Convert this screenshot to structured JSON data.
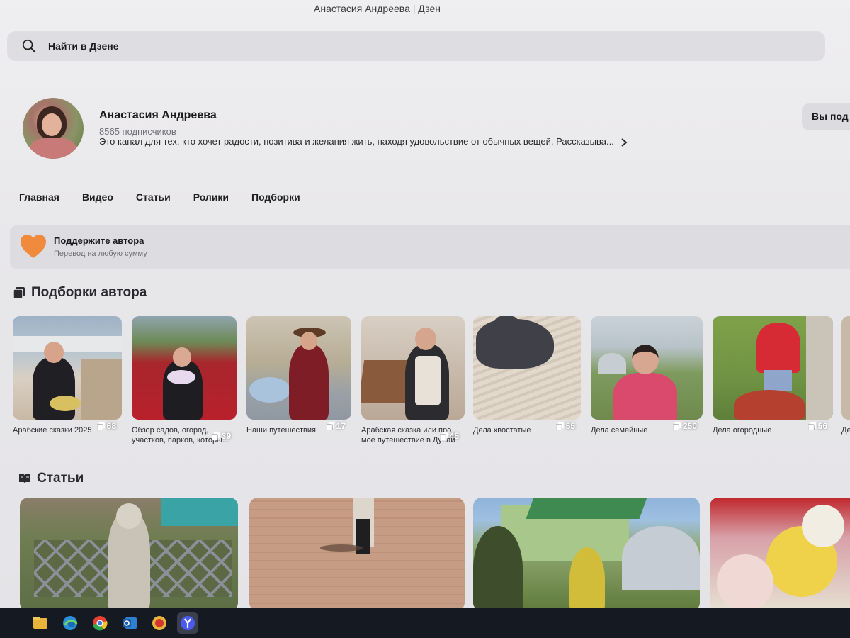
{
  "window": {
    "title": "Анастасия Андреева | Дзен"
  },
  "search": {
    "placeholder": "Найти в Дзене",
    "icon": "search-icon"
  },
  "channel": {
    "name": "Анастасия Андреева",
    "subscribers": "8565 подписчиков",
    "description": "Это канал для тех, кто хочет радости, позитива и желания жить, находя удовольствие от обычных вещей. Рассказыва...",
    "subscribe_label": "Вы под"
  },
  "tabs": [
    {
      "label": "Главная"
    },
    {
      "label": "Видео"
    },
    {
      "label": "Статьи"
    },
    {
      "label": "Ролики"
    },
    {
      "label": "Подборки"
    }
  ],
  "support": {
    "title": "Поддержите автора",
    "subtitle": "Перевод на любую сумму",
    "icon": "heart-icon",
    "color": "#f08a3c"
  },
  "collections_section": {
    "title": "Подборки автора",
    "items": [
      {
        "caption": "Арабские сказки 2025",
        "count": "68"
      },
      {
        "caption": "Обзор садов, огород, участков, парков, которы...",
        "count": "39"
      },
      {
        "caption": "Наши путешествия",
        "count": "17"
      },
      {
        "caption": "Арабская сказка или про мое путешествие в Дубай",
        "count": "45"
      },
      {
        "caption": "Дела хвостатые",
        "count": "55"
      },
      {
        "caption": "Дела семейные",
        "count": "250"
      },
      {
        "caption": "Дела огородные",
        "count": "56"
      },
      {
        "caption": "Де"
      }
    ]
  },
  "articles_section": {
    "title": "Статьи"
  },
  "taskbar": {
    "icons": [
      "file-explorer-icon",
      "edge-icon",
      "chrome-icon",
      "outlook-icon",
      "app-icon",
      "yandex-browser-icon"
    ]
  }
}
